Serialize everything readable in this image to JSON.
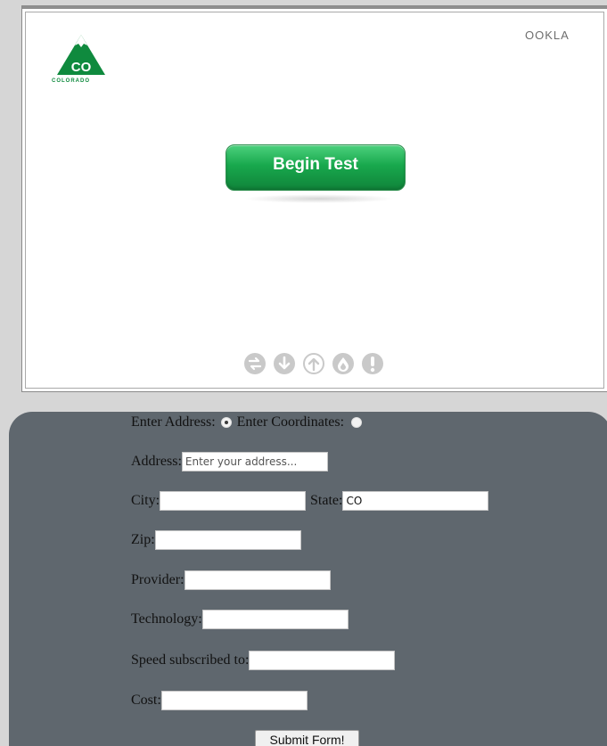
{
  "widget": {
    "logo_text": "COLORADO",
    "logo_abbrev": "CO",
    "ookla_text": "OOKLA",
    "begin_label": "Begin Test",
    "status_icons": [
      "latency-icon",
      "download-icon",
      "upload-icon",
      "jitter-icon",
      "alert-icon"
    ]
  },
  "form": {
    "mode_enter_address": "Enter Address:",
    "mode_enter_coordinates": "Enter Coordinates:",
    "address_label": "Address:",
    "address_placeholder": "Enter your address...",
    "city_label": "City:",
    "city_value": "",
    "state_label": "State:",
    "state_value": "CO",
    "zip_label": "Zip:",
    "zip_value": "",
    "provider_label": "Provider:",
    "provider_value": "",
    "technology_label": "Technology:",
    "technology_value": "",
    "speed_label": "Speed subscribed to:",
    "speed_value": "",
    "cost_label": "Cost:",
    "cost_value": "",
    "submit_label": "Submit Form!"
  },
  "colors": {
    "page_bg": "#d6d6d6",
    "panel_bg": "#5f676e",
    "button_green": "#18a84d",
    "icon_gray": "#c9c9c9"
  }
}
